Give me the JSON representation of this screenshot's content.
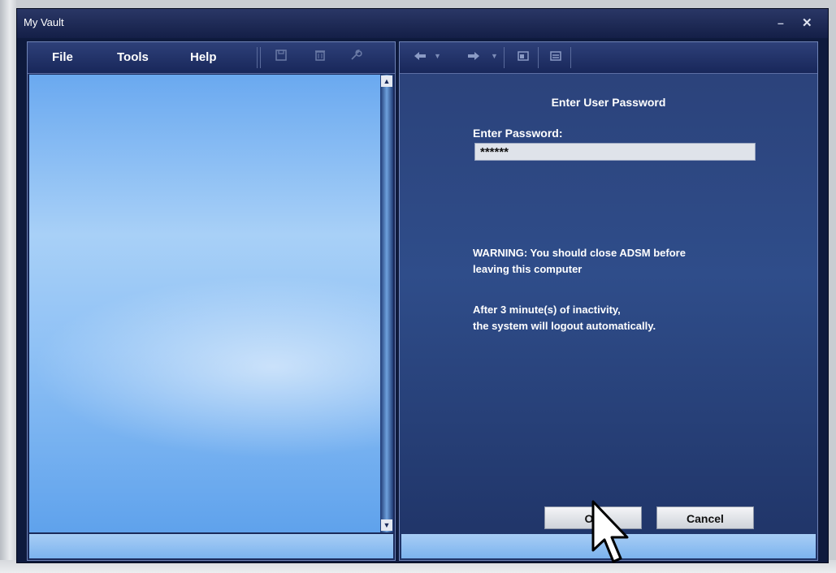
{
  "window": {
    "title": "My Vault",
    "minimize_glyph": "–",
    "close_glyph": "✕"
  },
  "menu": {
    "file": "File",
    "tools": "Tools",
    "help": "Help"
  },
  "left_toolbar_icons": [
    "save-icon",
    "delete-icon",
    "wrench-icon"
  ],
  "right_toolbar_icons": [
    "back-arrow-icon",
    "forward-arrow-icon",
    "window-icon",
    "list-icon"
  ],
  "dialog": {
    "title": "Enter User Password",
    "password_label": "Enter Password:",
    "password_value": "******",
    "warning_line1": "WARNING: You should close ADSM before",
    "warning_line2": "leaving this computer",
    "inactivity_line1": "After 3 minute(s) of inactivity,",
    "inactivity_line2": "the system will logout automatically.",
    "ok_label": "OK",
    "cancel_label": "Cancel"
  },
  "colors": {
    "window_frame": "#0e1a3d",
    "toolbar": "#1f2f63",
    "right_pane": "#2f4d8a",
    "left_content": "#8fc1f5"
  }
}
